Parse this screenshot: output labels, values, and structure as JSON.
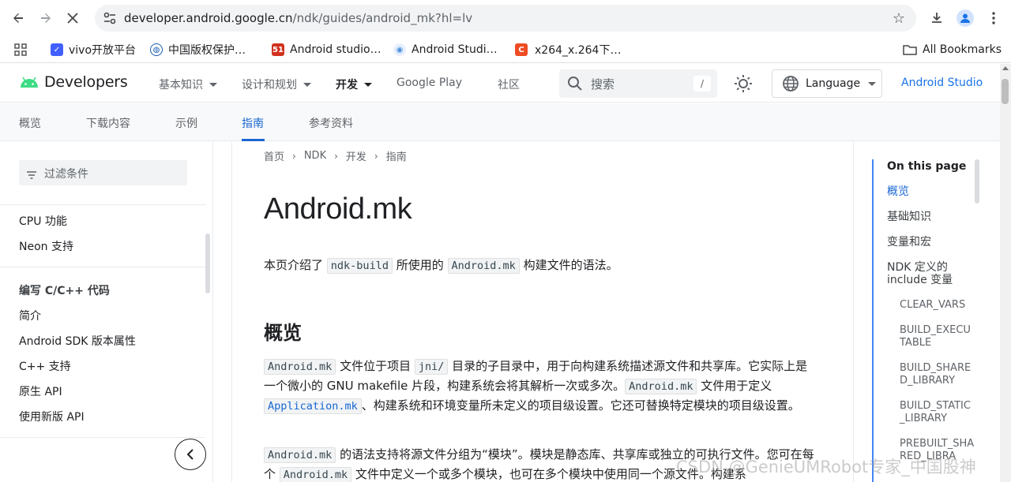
{
  "browser": {
    "url_main": "developer.android.google.cn",
    "url_path": "/ndk/guides/android_mk?hl=lv",
    "bookmarks": [
      {
        "label": "vivo开放平台",
        "color": "#415fff",
        "icon": "check-square-icon"
      },
      {
        "label": "中国版权保护…",
        "color": "#1a5fb4",
        "icon": "globe-icon"
      },
      {
        "label": "Android studio…",
        "color": "#d0321e",
        "icon": "51-icon"
      },
      {
        "label": "Android Studi…",
        "color": "#4a90d9",
        "icon": "android-studio-icon"
      },
      {
        "label": "x264_x.264下…",
        "color": "#ef4b23",
        "icon": "csdn-c-icon"
      }
    ],
    "all_bookmarks": "All Bookmarks"
  },
  "header": {
    "logo_text": "Developers",
    "nav": [
      {
        "label": "基本知识",
        "has_menu": true
      },
      {
        "label": "设计和规划",
        "has_menu": true
      },
      {
        "label": "开发",
        "has_menu": true
      },
      {
        "label": "Google Play",
        "has_menu": false
      },
      {
        "label": "社区",
        "has_menu": false
      }
    ],
    "search_placeholder": "搜索",
    "search_shortcut": "/",
    "language": "Language",
    "android_studio": "Android Studio"
  },
  "subtabs": [
    "概览",
    "下载内容",
    "示例",
    "指南",
    "参考资料"
  ],
  "sidebar": {
    "filter_placeholder": "过滤条件",
    "group1": [
      "CPU 功能",
      "Neon 支持"
    ],
    "group2_heading": "编写 C/C++ 代码",
    "group2": [
      "简介",
      "Android SDK 版本属性",
      "C++ 支持",
      "原生 API",
      "使用新版 API"
    ]
  },
  "breadcrumb": [
    "首页",
    "NDK",
    "开发",
    "指南"
  ],
  "main": {
    "title": "Android.mk",
    "intro": {
      "pre": "本页介绍了",
      "code1": "ndk-build",
      "mid": "所使用的",
      "code2": "Android.mk",
      "post": "构建文件的语法。"
    },
    "h2": "概览",
    "p1": {
      "code1": "Android.mk",
      "t1": "文件位于项目",
      "code2": "jni/",
      "t2": "目录的子目录中，用于向构建系统描述源文件和共享库。它实际上是一个微小的 GNU makefile 片段，构建系统会将其解析一次或多次。",
      "code3": "Android.mk",
      "t3": "文件用于定义",
      "code4": "Application.mk",
      "t4": "、构建系统和环境变量所未定义的项目级设置。它还可替换特定模块的项目级设置。"
    },
    "p2": {
      "code1": "Android.mk",
      "t1": "的语法支持将源文件分组为“模块”。模块是静态库、共享库或独立的可执行文件。您可在每个",
      "code2": "Android.mk",
      "t2": "文件中定义一个或多个模块，也可在多个模块中使用同一个源文件。构建系"
    }
  },
  "toc": {
    "title": "On this page",
    "items": [
      "概览",
      "基础知识",
      "变量和宏",
      "NDK 定义的 include 变量"
    ],
    "subitems": [
      "CLEAR_VARS",
      "BUILD_EXECUTABLE",
      "BUILD_SHARED_LIBRARY",
      "BUILD_STATIC_LIBRARY",
      "PREBUILT_SHARED_LIBRA"
    ]
  },
  "watermark": "CSDN @GenieUMRobot专家_中国股神",
  "colors": {
    "accent": "#1967d2",
    "link": "#1a73e8",
    "android_green": "#3ddc84"
  }
}
